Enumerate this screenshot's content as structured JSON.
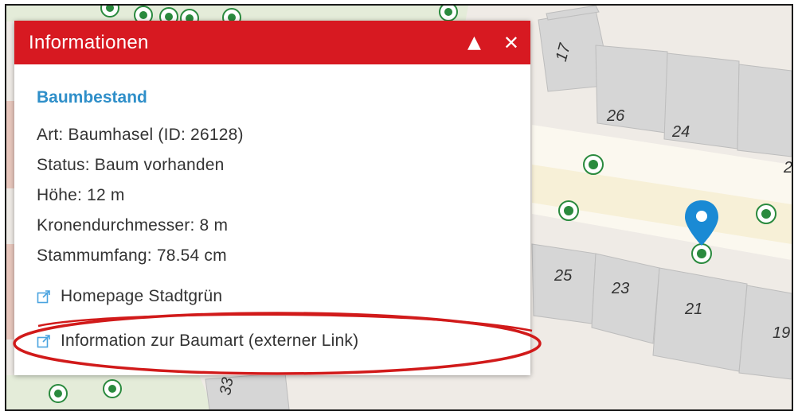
{
  "popup": {
    "title": "Informationen",
    "collapse_icon": "triangle-up-icon",
    "close_icon": "close-icon",
    "section_title": "Baumbestand",
    "attributes": [
      "Art: Baumhasel (ID: 26128)",
      "Status: Baum vorhanden",
      "Höhe: 12 m",
      "Kronendurchmesser: 8 m",
      "Stammumfang: 78.54 cm"
    ],
    "links": [
      "Homepage Stadtgrün",
      "Information zur Baumart (externer Link)"
    ]
  },
  "map": {
    "house_numbers": [
      "17",
      "26",
      "24",
      "2",
      "25",
      "23",
      "21",
      "19",
      "33"
    ],
    "marker_icon": "location-pin-icon",
    "tree_icon": "tree-point-icon"
  },
  "colors": {
    "header_red": "#d71921",
    "section_blue": "#2f8fc9",
    "pin_blue": "#1a8ad4",
    "tree_green": "#2a8a3e",
    "annotation_red": "#d11a1a"
  }
}
